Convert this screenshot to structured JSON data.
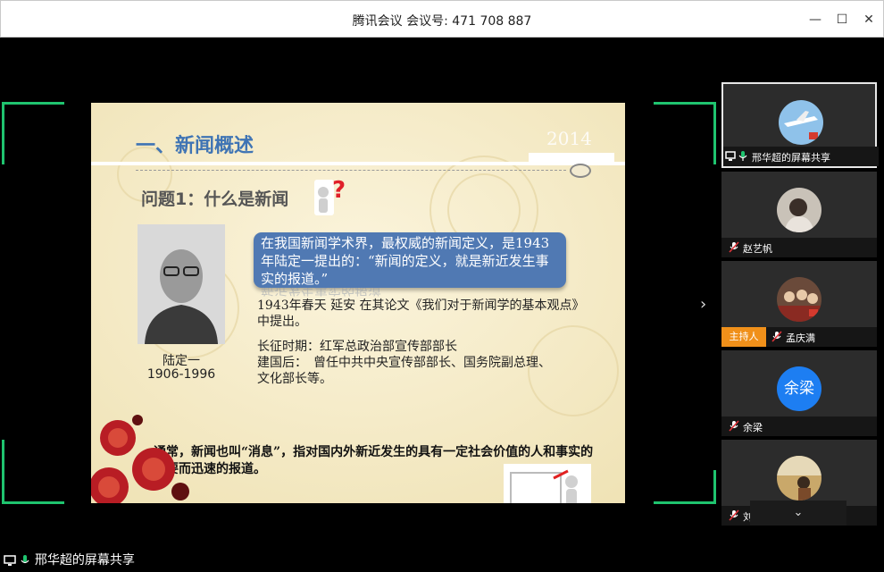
{
  "window": {
    "title": "腾讯会议 会议号: 471 708 887",
    "minimize": "—",
    "maximize": "☐",
    "close": "✕"
  },
  "slide": {
    "title": "一、新闻概述",
    "year": "2014",
    "question": "问题1：什么是新闻",
    "callout": "在我国新闻学术界，最权威的新闻定义，是1943年陆定一提出的：“新闻的定义，就是新近发生事实的报道。”",
    "callout_reflection": "新近发生事实的报道",
    "paragraph1": "1943年春天 延安 在其论文《我们对于新闻学的基本观点》中提出。",
    "paragraph2_line1": "长征时期：红军总政治部宣传部部长",
    "paragraph2_line2": "建国后：　曾任中共中央宣传部部长、国务院副总理、",
    "paragraph2_line3": "文化部长等。",
    "portrait_name": "陆定一",
    "portrait_years": "1906-1996",
    "bottom_text": "通常，新闻也叫“消息”，指对国内外新近发生的具有一定社会价值的人和事实的简要而迅速的报道。"
  },
  "participants": [
    {
      "name": "邢华超的屏幕共享",
      "avatar": "photo-plane",
      "mic": "on",
      "active": true
    },
    {
      "name": "赵艺帆",
      "avatar": "photo-girl",
      "mic": "muted"
    },
    {
      "name": "孟庆满",
      "avatar": "photo-group",
      "mic": "muted",
      "badge": "主持人"
    },
    {
      "name": "余梁",
      "avatar_text": "余梁",
      "mic": "muted"
    },
    {
      "name": "刘欢欢",
      "avatar": "photo-outdoor",
      "mic": "muted"
    }
  ],
  "panel": {
    "next_arrow": "›",
    "collapse_arrow": "⌄"
  },
  "share_bar": {
    "label": "邢华超的屏幕共享"
  },
  "colors": {
    "accent_green": "#1fc46f",
    "slide_title_blue": "#3f74b4",
    "callout_blue": "#5079b3",
    "host_orange": "#f0901a",
    "avatar_blue": "#1d7ef2",
    "mic_red": "#e0343a"
  }
}
